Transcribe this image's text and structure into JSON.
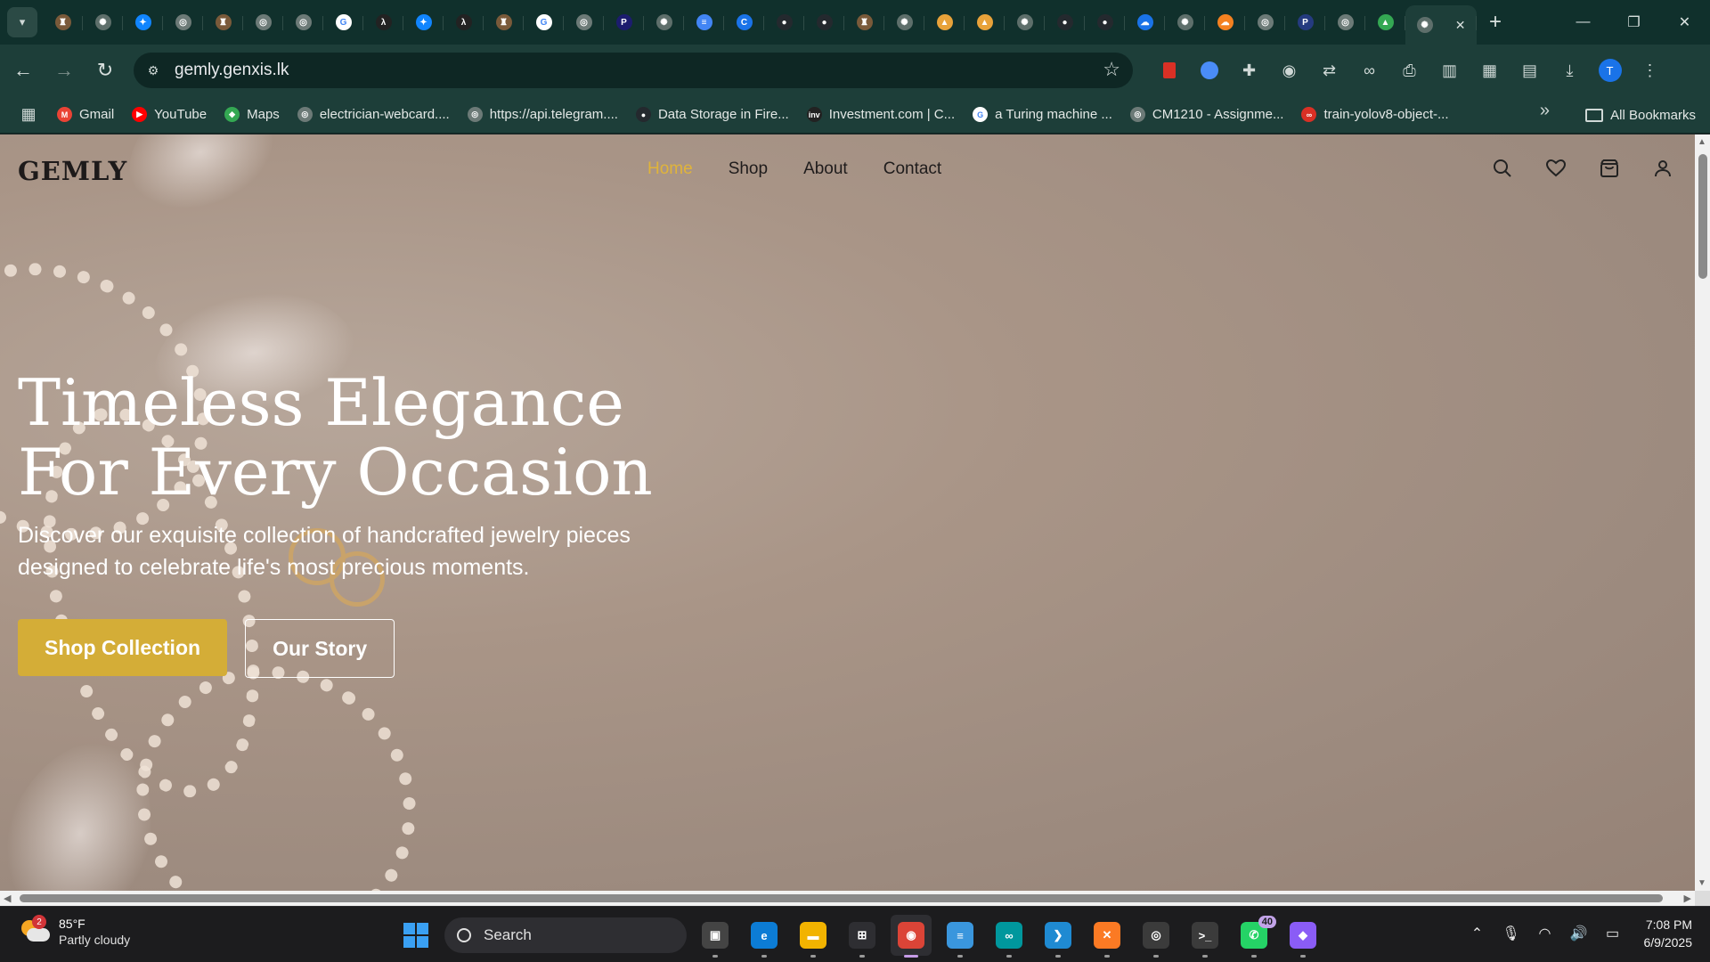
{
  "browser": {
    "tabs": [
      {
        "icon": "game-icon",
        "color": "#7a5a3a",
        "glyph": "♜"
      },
      {
        "icon": "openai-icon",
        "color": "#5e6f6b",
        "glyph": "✺"
      },
      {
        "icon": "bluesky-icon",
        "color": "#1185fe",
        "glyph": "✦"
      },
      {
        "icon": "globe-icon",
        "color": "#6c7a77",
        "glyph": "◎"
      },
      {
        "icon": "game-icon",
        "color": "#7a5a3a",
        "glyph": "♜"
      },
      {
        "icon": "globe-icon",
        "color": "#6c7a77",
        "glyph": "◎"
      },
      {
        "icon": "globe-icon",
        "color": "#6c7a77",
        "glyph": "◎"
      },
      {
        "icon": "google-icon",
        "color": "#ffffff",
        "glyph": "G"
      },
      {
        "icon": "code-icon",
        "color": "#222222",
        "glyph": "λ"
      },
      {
        "icon": "bluesky-icon",
        "color": "#1185fe",
        "glyph": "✦"
      },
      {
        "icon": "code-icon",
        "color": "#222222",
        "glyph": "λ"
      },
      {
        "icon": "game-icon",
        "color": "#7a5a3a",
        "glyph": "♜"
      },
      {
        "icon": "google-icon",
        "color": "#ffffff",
        "glyph": "G"
      },
      {
        "icon": "globe-icon",
        "color": "#6c7a77",
        "glyph": "◎"
      },
      {
        "icon": "p-icon",
        "color": "#1c1c6e",
        "glyph": "P"
      },
      {
        "icon": "openai-icon",
        "color": "#5e6f6b",
        "glyph": "✺"
      },
      {
        "icon": "docs-icon",
        "color": "#4285f4",
        "glyph": "≡"
      },
      {
        "icon": "c-icon",
        "color": "#1a73e8",
        "glyph": "C"
      },
      {
        "icon": "github-icon",
        "color": "#24292e",
        "glyph": "●"
      },
      {
        "icon": "github-icon",
        "color": "#24292e",
        "glyph": "●"
      },
      {
        "icon": "game-icon",
        "color": "#7a5a3a",
        "glyph": "♜"
      },
      {
        "icon": "openai-icon",
        "color": "#5e6f6b",
        "glyph": "✺"
      },
      {
        "icon": "mountain-icon",
        "color": "#e8a23a",
        "glyph": "▲"
      },
      {
        "icon": "mountain-icon",
        "color": "#e8a23a",
        "glyph": "▲"
      },
      {
        "icon": "openai-icon",
        "color": "#5e6f6b",
        "glyph": "✺"
      },
      {
        "icon": "github-icon",
        "color": "#24292e",
        "glyph": "●"
      },
      {
        "icon": "github-icon",
        "color": "#24292e",
        "glyph": "●"
      },
      {
        "icon": "cloud-icon",
        "color": "#1a73e8",
        "glyph": "☁"
      },
      {
        "icon": "openai-icon",
        "color": "#5e6f6b",
        "glyph": "✺"
      },
      {
        "icon": "cloudflare-icon",
        "color": "#f48120",
        "glyph": "☁"
      },
      {
        "icon": "globe-icon",
        "color": "#6c7a77",
        "glyph": "◎"
      },
      {
        "icon": "paypal-icon",
        "color": "#253b80",
        "glyph": "P"
      },
      {
        "icon": "globe-icon",
        "color": "#6c7a77",
        "glyph": "◎"
      },
      {
        "icon": "drive-icon",
        "color": "#34a853",
        "glyph": "▲"
      }
    ],
    "active_tab": {
      "icon": "openai-icon",
      "color": "#5e6f6b",
      "glyph": "✺",
      "close": "✕"
    },
    "new_tab": "+",
    "window_controls": {
      "minimize": "—",
      "restore": "❐",
      "close": "✕"
    },
    "url": "gemly.genxis.lk",
    "bookmarks": [
      {
        "label": "Gmail",
        "icon": "gmail-icon",
        "color": "#ea4335",
        "glyph": "M"
      },
      {
        "label": "YouTube",
        "icon": "youtube-icon",
        "color": "#ff0000",
        "glyph": "▶"
      },
      {
        "label": "Maps",
        "icon": "maps-icon",
        "color": "#34a853",
        "glyph": "◆"
      },
      {
        "label": "electrician-webcard....",
        "icon": "globe-icon",
        "color": "#6c7a77",
        "glyph": "◎"
      },
      {
        "label": "https://api.telegram....",
        "icon": "globe-icon",
        "color": "#6c7a77",
        "glyph": "◎"
      },
      {
        "label": "Data Storage in Fire...",
        "icon": "github-icon",
        "color": "#24292e",
        "glyph": "●"
      },
      {
        "label": "Investment.com | C...",
        "icon": "investing-icon",
        "color": "#222222",
        "glyph": "inv"
      },
      {
        "label": "a Turing machine ...",
        "icon": "google-icon",
        "color": "#ffffff",
        "glyph": "G"
      },
      {
        "label": "CM1210 - Assignme...",
        "icon": "globe-icon",
        "color": "#6c7a77",
        "glyph": "◎"
      },
      {
        "label": "train-yolov8-object-...",
        "icon": "roboflow-icon",
        "color": "#d93025",
        "glyph": "∞"
      }
    ],
    "more_bookmarks": "»",
    "all_bookmarks": "All Bookmarks"
  },
  "site": {
    "logo": "GEMLY",
    "nav": [
      {
        "label": "Home",
        "active": true
      },
      {
        "label": "Shop",
        "active": false
      },
      {
        "label": "About",
        "active": false
      },
      {
        "label": "Contact",
        "active": false
      }
    ],
    "hero": {
      "title_line1": "Timeless Elegance",
      "title_line2": "For Every Occasion",
      "subtitle": "Discover our exquisite collection of handcrafted jewelry pieces designed to celebrate life's most precious moments.",
      "primary_cta": "Shop Collection",
      "secondary_cta": "Our Story"
    },
    "colors": {
      "accent": "#d4ad37",
      "nav_active": "#e0b43a"
    }
  },
  "taskbar": {
    "weather": {
      "temp": "85°F",
      "desc": "Partly cloudy",
      "badge": "2"
    },
    "search_placeholder": "Search",
    "apps": [
      {
        "name": "task-view",
        "color": "#444",
        "glyph": "▣"
      },
      {
        "name": "edge",
        "color": "#0c7cd5",
        "glyph": "e"
      },
      {
        "name": "file-explorer",
        "color": "#f2b300",
        "glyph": "▬"
      },
      {
        "name": "microsoft-store",
        "color": "#2e2e32",
        "glyph": "⊞"
      },
      {
        "name": "chrome",
        "color": "#db4437",
        "glyph": "◉",
        "active": true
      },
      {
        "name": "notepad",
        "color": "#3a96dd",
        "glyph": "≡"
      },
      {
        "name": "arduino",
        "color": "#00979d",
        "glyph": "∞"
      },
      {
        "name": "vscode",
        "color": "#1f8ad2",
        "glyph": "❯"
      },
      {
        "name": "xampp",
        "color": "#fb7a24",
        "glyph": "✕"
      },
      {
        "name": "obs",
        "color": "#3b3b3b",
        "glyph": "◎"
      },
      {
        "name": "terminal",
        "color": "#3b3b3b",
        "glyph": ">_"
      },
      {
        "name": "whatsapp",
        "color": "#25d366",
        "glyph": "✆",
        "badge": "40"
      },
      {
        "name": "copilot",
        "color": "#8a5cf6",
        "glyph": "◆"
      }
    ],
    "time": "7:08 PM",
    "date": "6/9/2025"
  }
}
